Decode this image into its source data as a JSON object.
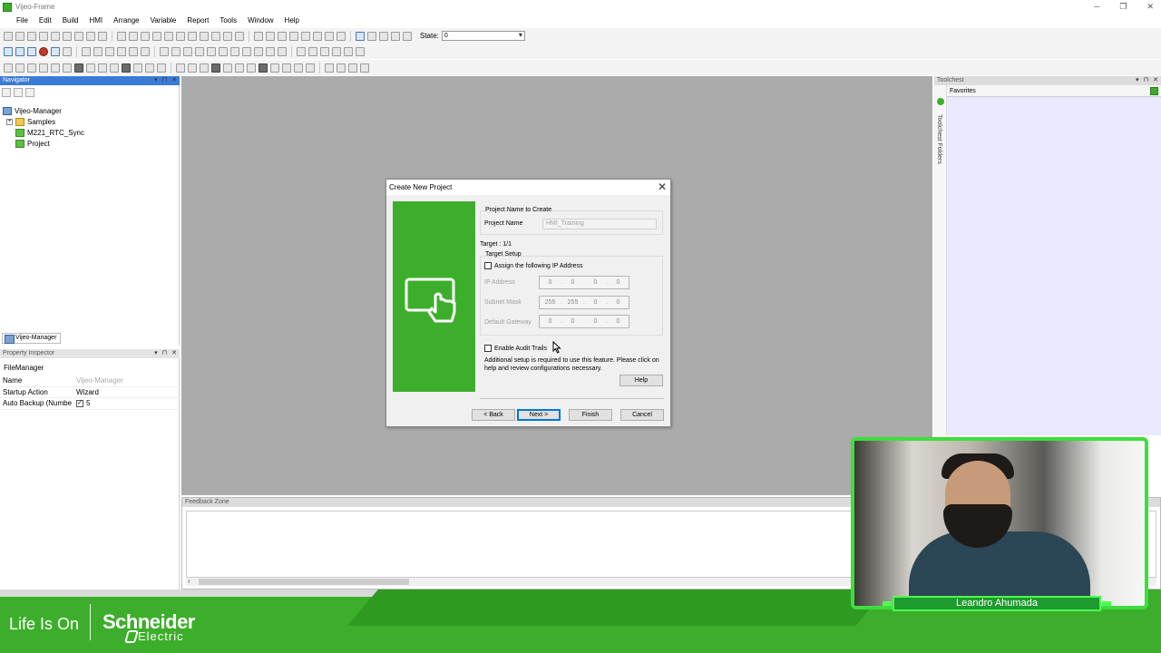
{
  "window": {
    "title": "Vijeo-Frame",
    "controls": [
      "─",
      "❐",
      "✕"
    ]
  },
  "menu": [
    "File",
    "Edit",
    "Build",
    "HMI",
    "Arrange",
    "Variable",
    "Report",
    "Tools",
    "Window",
    "Help"
  ],
  "toolbar": {
    "state_label": "State:",
    "state_value": "0"
  },
  "navigator": {
    "title": "Navigator",
    "tree": [
      {
        "label": "Vijeo-Manager",
        "kind": "root"
      },
      {
        "label": "Samples",
        "kind": "folder"
      },
      {
        "label": "M221_RTC_Sync",
        "kind": "project"
      },
      {
        "label": "Project",
        "kind": "project"
      }
    ],
    "tab": "Vijeo-Manager"
  },
  "property_inspector": {
    "title": "Property Inspector",
    "object": "FileManager",
    "rows": [
      {
        "key": "Name",
        "value": "Vijeo-Manager",
        "muted": true
      },
      {
        "key": "Startup Action",
        "value": "Wizard",
        "muted": false
      },
      {
        "key": "Auto Backup (Numbe",
        "value": "5",
        "checked": true
      }
    ]
  },
  "toolchest": {
    "title": "Toolchest",
    "favorites": "Favorites",
    "folders_label": "Toolchest Folders"
  },
  "feedback": {
    "title": "Feedback Zone"
  },
  "dialog": {
    "title": "Create New Project",
    "group_project": "Project Name to Create",
    "project_name_label": "Project Name",
    "project_name_value": "HMI_Training",
    "target_label": "Target : 1/1",
    "group_target": "Target Setup",
    "assign_ip_label": "Assign the following IP Address",
    "ip_address_label": "IP Address",
    "ip_address": [
      "0",
      "0",
      "0",
      "0"
    ],
    "subnet_label": "Subnet Mask",
    "subnet": [
      "255",
      "255",
      "0",
      "0"
    ],
    "gateway_label": "Default Gateway",
    "gateway": [
      "0",
      "0",
      "0",
      "0"
    ],
    "audit_label": "Enable Audit Trails",
    "audit_note": "Additional setup is required to use this feature. Please click on help and review configurations necessary.",
    "help_button": "Help",
    "back_button": "< Back",
    "next_button": "Next >",
    "finish_button": "Finish",
    "cancel_button": "Cancel"
  },
  "webcam": {
    "name": "Leandro Ahumada"
  },
  "footer": {
    "slogan": "Life Is On",
    "brand": "Schneider",
    "brand_sub": "Electric"
  },
  "colors": {
    "accent_green": "#3dae2b",
    "webcam_frame": "#3dde3d",
    "workspace": "#ababab"
  }
}
